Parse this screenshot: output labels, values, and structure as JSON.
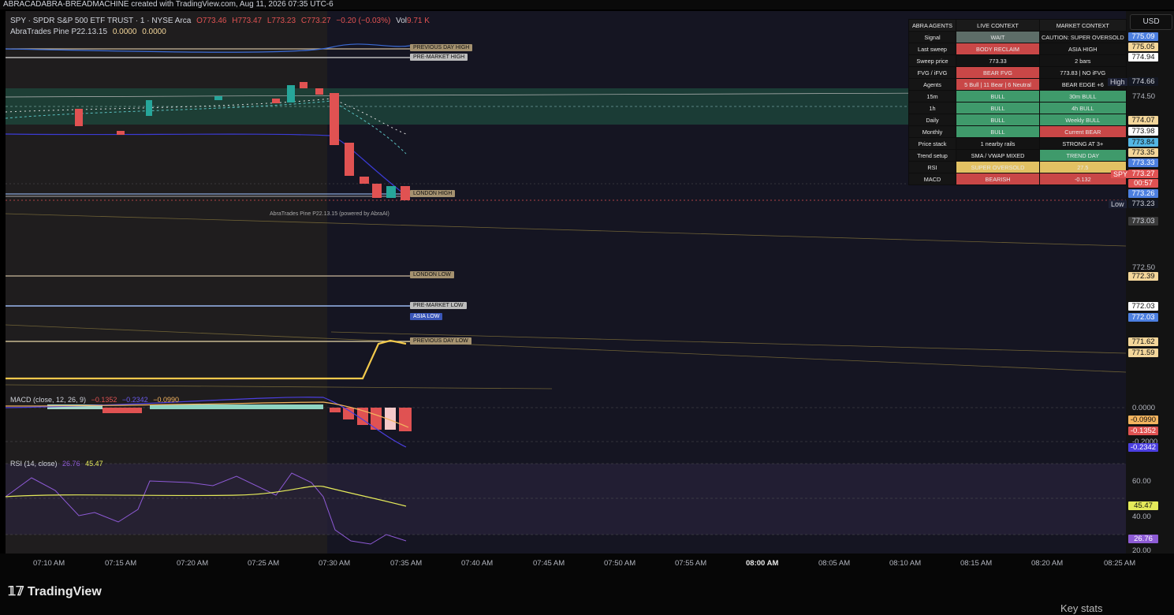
{
  "header": {
    "credit": "ABRACADABRA-BREADMACHINE created with TradingView.com, Aug 11, 2026 07:35 UTC-6"
  },
  "symbol": {
    "title": "SPY · SPDR S&P 500 ETF TRUST · 1 · NYSE Arca",
    "o": "O773.46",
    "h": "H773.47",
    "l": "L773.23",
    "c": "C773.27",
    "chg": "−0.20 (−0.03%)",
    "vol_label": "Vol",
    "vol": "9.71 K"
  },
  "indicator": {
    "name": "AbraTrades Pine P22.13.15",
    "v1": "0.0000",
    "v2": "0.0000",
    "watermark": "AbraTrades Pine P22.13.15 (powered by AbraAI)"
  },
  "level_labels": {
    "pdh": "PREVIOUS DAY HIGH",
    "pmh": "PRE-MARKET HIGH",
    "london_high": "LONDON HIGH",
    "london_low": "LONDON LOW",
    "pml": "PRE-MARKET LOW",
    "asia_low": "ASIA LOW",
    "pdl": "PREVIOUS DAY LOW"
  },
  "macd": {
    "label": "MACD (close, 12, 26, 9)",
    "v1": "−0.1352",
    "v2": "−0.2342",
    "v3": "−0.0990"
  },
  "rsi": {
    "label": "RSI (14, close)",
    "v1": "26.76",
    "v2": "45.47"
  },
  "abra_table": {
    "headers": [
      "ABRA AGENTS",
      "LIVE CONTEXT",
      "MARKET CONTEXT"
    ],
    "rows": [
      {
        "name": "Signal",
        "live": "WAIT",
        "market": "CAUTION: SUPER OVERSOLD",
        "live_bg": "#5d6d68",
        "market_bg": "#131313"
      },
      {
        "name": "Last sweep",
        "live": "BODY RECLAIM",
        "market": "ASIA HIGH",
        "live_bg": "#c94747",
        "market_bg": "#131313"
      },
      {
        "name": "Sweep price",
        "live": "773.33",
        "market": "2 bars",
        "live_bg": "#131313",
        "market_bg": "#131313"
      },
      {
        "name": "FVG / iFVG",
        "live": "BEAR FVG",
        "market": "773.83 | NO iFVG",
        "live_bg": "#c94747",
        "market_bg": "#131313"
      },
      {
        "name": "Agents",
        "live": "5 Bull | 11 Bear | 6 Neutral",
        "market": "BEAR EDGE +6",
        "live_bg": "#c94747",
        "market_bg": "#131313"
      },
      {
        "name": "15m",
        "live": "BULL",
        "market": "30m BULL",
        "live_bg": "#3f9a6b",
        "market_bg": "#3f9a6b"
      },
      {
        "name": "1h",
        "live": "BULL",
        "market": "4h BULL",
        "live_bg": "#3f9a6b",
        "market_bg": "#3f9a6b"
      },
      {
        "name": "Daily",
        "live": "BULL",
        "market": "Weekly BULL",
        "live_bg": "#3f9a6b",
        "market_bg": "#3f9a6b"
      },
      {
        "name": "Monthly",
        "live": "BULL",
        "market": "Current BEAR",
        "live_bg": "#3f9a6b",
        "market_bg": "#c94747"
      },
      {
        "name": "Price stack",
        "live": "1 nearby rails",
        "market": "STRONG AT 3+",
        "live_bg": "#131313",
        "market_bg": "#131313"
      },
      {
        "name": "Trend setup",
        "live": "SMA / VWAP MIXED",
        "market": "TREND DAY",
        "live_bg": "#131313",
        "market_bg": "#3f9a6b"
      },
      {
        "name": "RSI",
        "live": "SUPER OVERSOLD",
        "market": "27.5",
        "live_bg": "#e2c163",
        "market_bg": "#e2c163"
      },
      {
        "name": "MACD",
        "live": "BEARISH",
        "market": "-0.132",
        "live_bg": "#c94747",
        "market_bg": "#c94747"
      }
    ]
  },
  "price_scale": {
    "currency": "USD",
    "plain_ticks": [
      "774.50",
      "772.50",
      "0.0000",
      "-0.2000",
      "60.00",
      "40.00",
      "20.00"
    ],
    "labels": [
      {
        "text": "775.09",
        "bg": "#4c7fe0",
        "fg": "#ffffff"
      },
      {
        "text": "775.05",
        "bg": "#f3d69a",
        "fg": "#111111"
      },
      {
        "text": "774.94",
        "bg": "#ffffff",
        "fg": "#111111"
      },
      {
        "text": "774.66",
        "bg": "#131722",
        "fg": "#d1d4dc"
      },
      {
        "text": "774.07",
        "bg": "#f3d69a",
        "fg": "#111111"
      },
      {
        "text": "773.98",
        "bg": "#ffffff",
        "fg": "#111111"
      },
      {
        "text": "773.84",
        "bg": "#53b6e4",
        "fg": "#111111"
      },
      {
        "text": "773.35",
        "bg": "#f3d69a",
        "fg": "#111111"
      },
      {
        "text": "773.33",
        "bg": "#4c7fe0",
        "fg": "#ffffff"
      },
      {
        "text": "773.27",
        "bg": "#e05252",
        "fg": "#ffffff"
      },
      {
        "text": "00:57",
        "bg": "#e05252",
        "fg": "#ffffff"
      },
      {
        "text": "773.26",
        "bg": "#4c7fe0",
        "fg": "#ffffff"
      },
      {
        "text": "773.23",
        "bg": "#131722",
        "fg": "#d1d4dc"
      },
      {
        "text": "773.03",
        "bg": "#3a3a3a",
        "fg": "#d1d4dc"
      },
      {
        "text": "772.39",
        "bg": "#f3d69a",
        "fg": "#111111"
      },
      {
        "text": "772.03",
        "bg": "#ffffff",
        "fg": "#111111"
      },
      {
        "text": "772.03",
        "bg": "#4c7fe0",
        "fg": "#ffffff"
      },
      {
        "text": "771.62",
        "bg": "#f3d69a",
        "fg": "#111111"
      },
      {
        "text": "771.59",
        "bg": "#f3d69a",
        "fg": "#111111"
      },
      {
        "text": "-0.0990",
        "bg": "#f3b45f",
        "fg": "#111111"
      },
      {
        "text": "-0.1352",
        "bg": "#e05252",
        "fg": "#ffffff"
      },
      {
        "text": "-0.2342",
        "bg": "#4b3fe0",
        "fg": "#ffffff"
      },
      {
        "text": "45.47",
        "bg": "#e5ea5a",
        "fg": "#111111"
      },
      {
        "text": "26.76",
        "bg": "#8d5bd4",
        "fg": "#ffffff"
      }
    ],
    "high_tag": "High",
    "low_tag": "Low",
    "spy_tag": "SPY"
  },
  "time_axis": [
    "07:10 AM",
    "07:15 AM",
    "07:20 AM",
    "07:25 AM",
    "07:30 AM",
    "07:35 AM",
    "07:40 AM",
    "07:45 AM",
    "07:50 AM",
    "07:55 AM",
    "08:00 AM",
    "08:05 AM",
    "08:10 AM",
    "08:15 AM",
    "08:20 AM",
    "08:25 AM"
  ],
  "footer": {
    "brand": "TradingView",
    "key_stats": "Key stats"
  },
  "colors": {
    "bull": "#26a69a",
    "bear": "#e05252",
    "gold": "#f2c94c",
    "rsi": "#8e5ad6"
  }
}
